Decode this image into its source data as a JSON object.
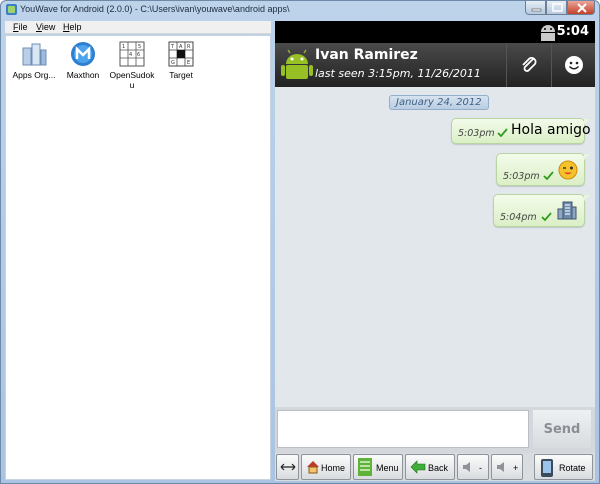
{
  "window": {
    "title": "YouWave for Android (2.0.0) - C:\\Users\\ivan\\youwave\\android apps\\"
  },
  "menubar": {
    "items": [
      "File",
      "View",
      "Help"
    ]
  },
  "apps": [
    {
      "label": "Apps Org...",
      "icon": "apps-organizer-icon"
    },
    {
      "label": "Maxthon",
      "icon": "maxthon-icon"
    },
    {
      "label": "OpenSudoku",
      "icon": "sudoku-icon"
    },
    {
      "label": "Target",
      "icon": "target-grid-icon"
    }
  ],
  "statusbar": {
    "time": "5:04"
  },
  "chat": {
    "contact_name": "Ivan Ramirez",
    "last_seen": "last seen 3:15pm, 11/26/2011",
    "date": "January 24, 2012",
    "messages": [
      {
        "time": "5:03pm",
        "text": "Hola amigo",
        "status": "sent-check"
      },
      {
        "time": "5:03pm",
        "emoji": "winking-face-emoji",
        "status": "sent-check"
      },
      {
        "time": "5:04pm",
        "emoji": "building-emoji",
        "status": "sent-check"
      }
    ],
    "input_placeholder": "",
    "send_label": "Send"
  },
  "toolbar": {
    "home_label": "Home",
    "menu_label": "Menu",
    "back_label": "Back",
    "vol_down_label": "-",
    "vol_up_label": "+",
    "rotate_label": "Rotate"
  },
  "colors": {
    "bubble": "#dbefc6",
    "header": "#2b2b2b",
    "accent_check": "#2f9d1d"
  }
}
